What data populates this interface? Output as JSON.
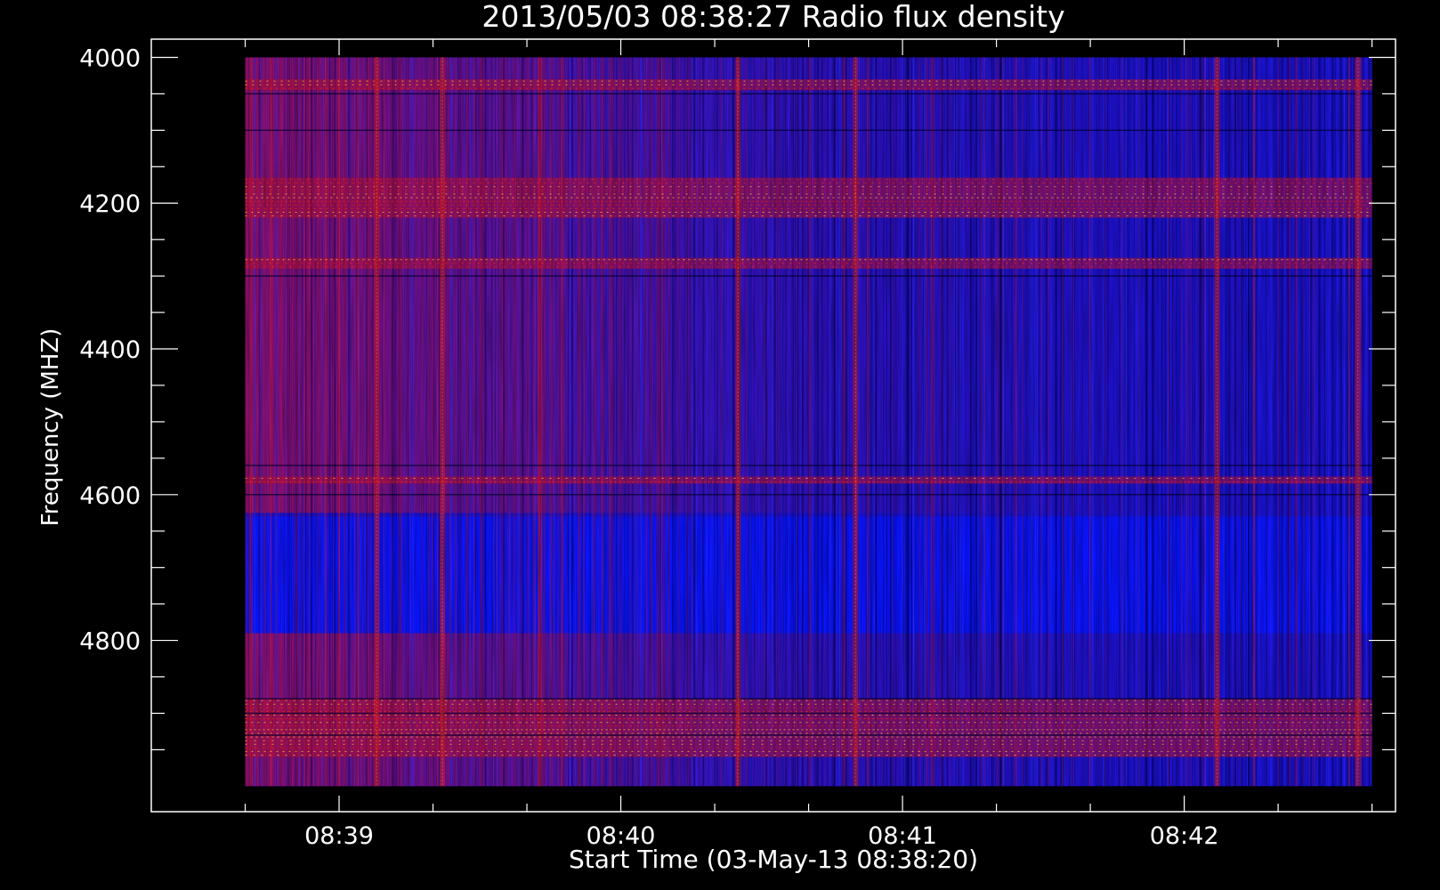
{
  "chart_data": {
    "type": "heatmap",
    "title": "2013/05/03 08:38:27 Radio flux density",
    "xlabel": "Start Time (03-May-13 08:38:20)",
    "ylabel": "Frequency (MHZ)",
    "xlim": [
      "08:38:20",
      "08:42:45"
    ],
    "ylim": [
      4000,
      5000
    ],
    "y_inverted": true,
    "data_x_range": [
      "08:38:40",
      "08:42:40"
    ],
    "data_y_range": [
      4000,
      5000
    ],
    "x_ticks": [
      {
        "value": "08:39",
        "label": "08:39"
      },
      {
        "value": "08:40",
        "label": "08:40"
      },
      {
        "value": "08:41",
        "label": "08:41"
      },
      {
        "value": "08:42",
        "label": "08:42"
      }
    ],
    "x_minor_step_seconds": 20,
    "y_ticks": [
      {
        "value": 4000,
        "label": "4000"
      },
      {
        "value": 4200,
        "label": "4200"
      },
      {
        "value": 4400,
        "label": "4400"
      },
      {
        "value": 4600,
        "label": "4600"
      },
      {
        "value": 4800,
        "label": "4800"
      }
    ],
    "y_minor_step": 50,
    "grid": false,
    "colormap": [
      "#000000",
      "#0000ff",
      "#ff0000",
      "#ffff99"
    ],
    "background": "#000000",
    "axis_color": "#ffffff",
    "bright_frequency_bands_mhz": [
      [
        4030,
        4045
      ],
      [
        4165,
        4220
      ],
      [
        4275,
        4290
      ],
      [
        4575,
        4585
      ],
      [
        4880,
        4960
      ]
    ],
    "quiet_frequency_band_mhz": [
      4630,
      4790
    ],
    "bright_time_columns": [
      "08:39:08",
      "08:39:22",
      "08:40:25",
      "08:40:50",
      "08:42:07",
      "08:42:37"
    ]
  }
}
